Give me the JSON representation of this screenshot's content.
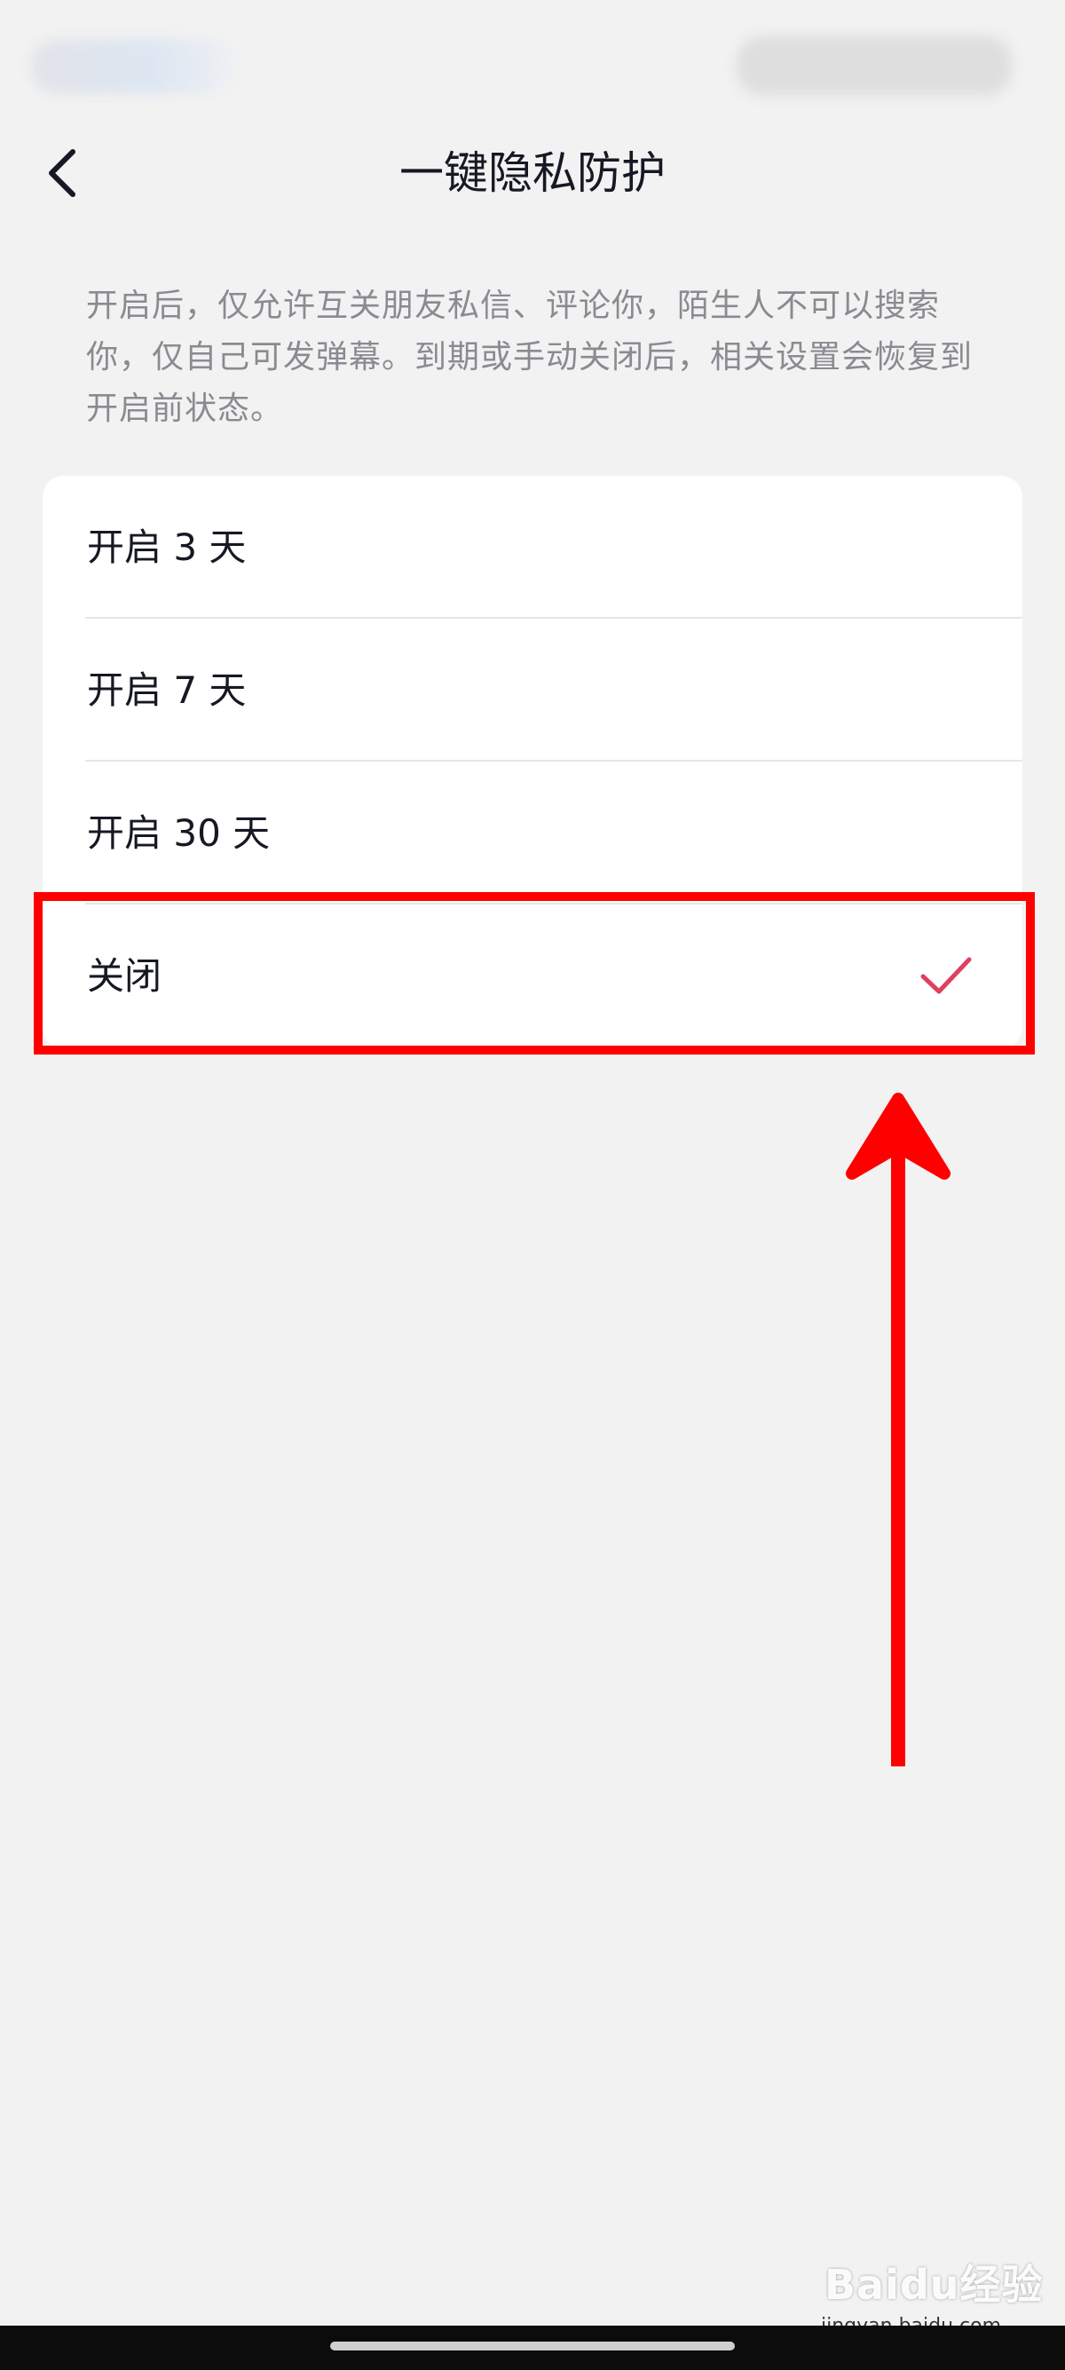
{
  "header": {
    "title": "一键隐私防护",
    "back_icon": "chevron-left-icon"
  },
  "description": "开启后，仅允许互关朋友私信、评论你，陌生人不可以搜索你，仅自己可发弹幕。到期或手动关闭后，相关设置会恢复到开启前状态。",
  "options": [
    {
      "label": "开启 3 天",
      "selected": false
    },
    {
      "label": "开启 7 天",
      "selected": false
    },
    {
      "label": "开启 30 天",
      "selected": false
    },
    {
      "label": "关闭",
      "selected": true
    }
  ],
  "selected_icon": "checkmark-icon",
  "watermark": {
    "brand": "Baidu经验",
    "url": "jingyan.baidu.com"
  },
  "colors": {
    "accent_check": "#fe2c55",
    "annotation": "#ff0000",
    "background": "#f2f2f2"
  }
}
